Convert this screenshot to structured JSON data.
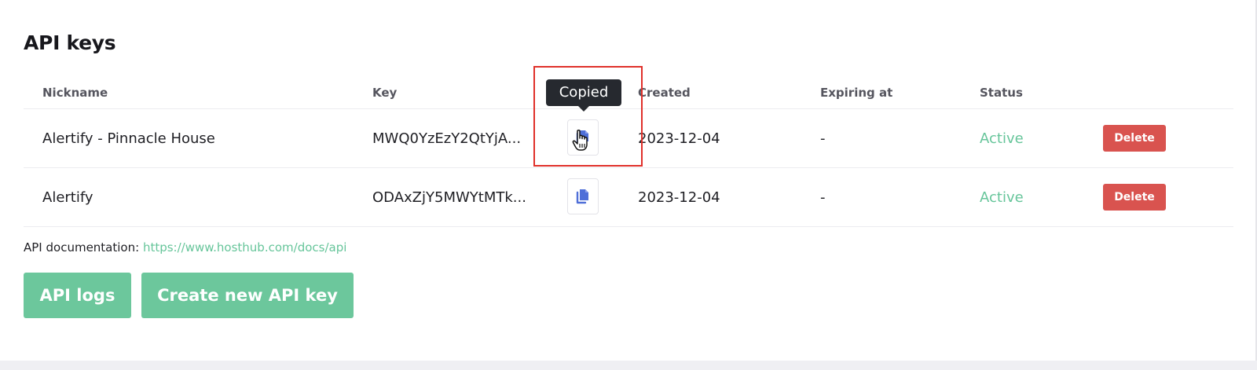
{
  "title": "API keys",
  "table": {
    "headers": {
      "nickname": "Nickname",
      "key": "Key",
      "created": "Created",
      "expiring": "Expiring at",
      "status": "Status"
    },
    "rows": [
      {
        "nickname": "Alertify - Pinnacle House",
        "key": "MWQ0YzEzY2QtYjA...",
        "created": "2023-12-04",
        "expiring": "-",
        "status": "Active",
        "delete_label": "Delete"
      },
      {
        "nickname": "Alertify",
        "key": "ODAxZjY5MWYtMTk...",
        "created": "2023-12-04",
        "expiring": "-",
        "status": "Active",
        "delete_label": "Delete"
      }
    ]
  },
  "tooltip": "Copied",
  "docs": {
    "label": "API documentation:",
    "link": "https://www.hosthub.com/docs/api"
  },
  "buttons": {
    "logs": "API logs",
    "create": "Create new API key"
  },
  "icons": {
    "copy": "copy-icon",
    "cursor": "hand-pointer-cursor"
  },
  "colors": {
    "accent_green": "#6cc79c",
    "status_active": "#66c59a",
    "delete_red": "#d9534f",
    "copy_icon_blue": "#4f6fd8",
    "highlight_red": "#e0302a",
    "tooltip_bg": "#26292f"
  }
}
